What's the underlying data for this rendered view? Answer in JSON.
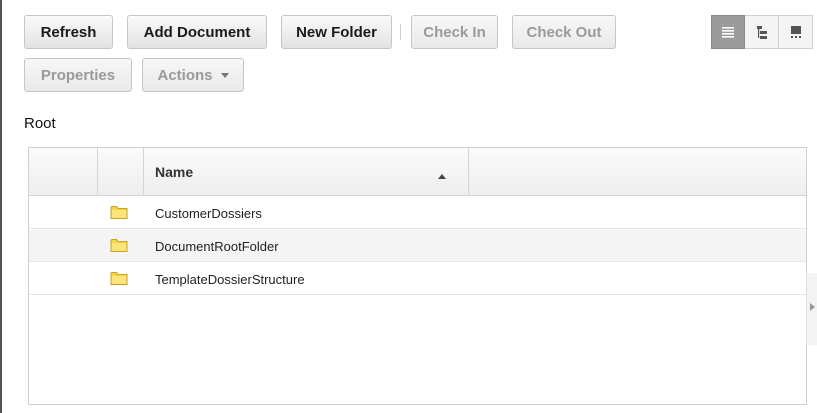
{
  "toolbar": {
    "refresh_label": "Refresh",
    "add_document_label": "Add Document",
    "new_folder_label": "New Folder",
    "check_in_label": "Check In",
    "check_out_label": "Check Out",
    "properties_label": "Properties",
    "actions_label": "Actions"
  },
  "view_modes": [
    "details-view-icon",
    "tree-view-icon",
    "thumbnail-view-icon"
  ],
  "breadcrumb": "Root",
  "grid": {
    "columns": [
      "",
      "",
      "Name",
      ""
    ],
    "sort": "ascending",
    "rows": [
      {
        "name": "CustomerDossiers",
        "icon": "folder-icon"
      },
      {
        "name": "DocumentRootFolder",
        "icon": "folder-icon"
      },
      {
        "name": "TemplateDossierStructure",
        "icon": "folder-icon"
      }
    ]
  },
  "colors": {
    "folder_fill": "#f5d44a",
    "folder_stroke": "#c9a21e",
    "active_view_bg": "#9b9b9b",
    "disabled_text": "#9a9a9a"
  }
}
